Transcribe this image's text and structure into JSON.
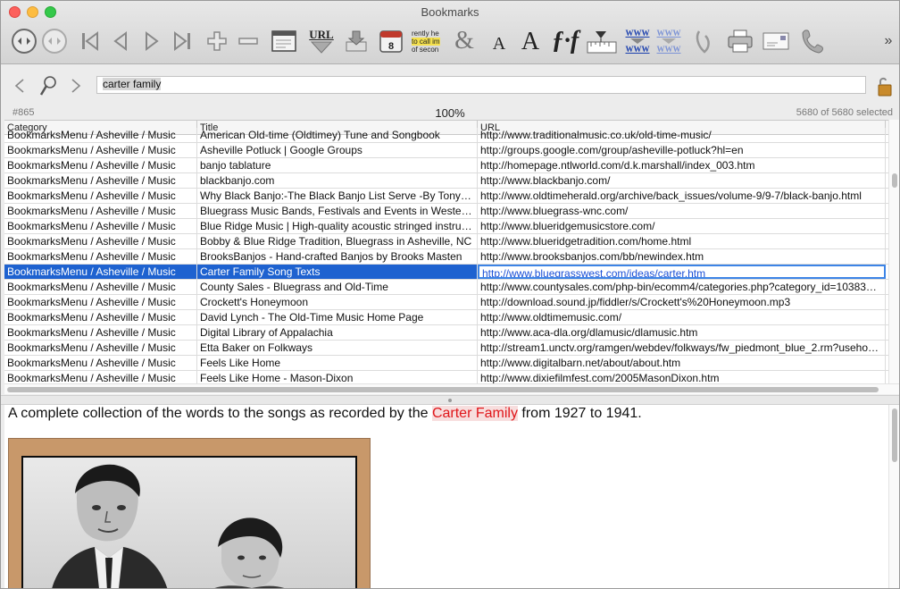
{
  "window": {
    "title": "Bookmarks"
  },
  "toolbar": {
    "items": [
      {
        "name": "navigate-back-icon"
      },
      {
        "name": "navigate-forward-icon"
      },
      {
        "name": "first-record-icon"
      },
      {
        "name": "previous-record-icon"
      },
      {
        "name": "next-record-icon"
      },
      {
        "name": "last-record-icon"
      },
      {
        "name": "add-record-icon"
      },
      {
        "name": "delete-record-icon"
      },
      {
        "name": "window-icon"
      },
      {
        "name": "url-download-icon"
      },
      {
        "name": "open-tray-icon"
      },
      {
        "name": "calendar-icon"
      },
      {
        "name": "text-preview-icon"
      },
      {
        "name": "ampersand-icon"
      },
      {
        "name": "font-smaller-icon"
      },
      {
        "name": "font-larger-icon"
      },
      {
        "name": "function-icon"
      },
      {
        "name": "ruler-icon"
      },
      {
        "name": "www-link-icon"
      },
      {
        "name": "www-unlink-icon"
      },
      {
        "name": "clip-icon"
      },
      {
        "name": "printer-icon"
      },
      {
        "name": "envelope-icon"
      },
      {
        "name": "phone-icon"
      },
      {
        "name": "overflow-chevron-icon"
      }
    ],
    "url_label": "URL",
    "calendar_day": "8",
    "preview_lines": [
      "rently he",
      "to call im",
      "of secon"
    ],
    "font_a": "A",
    "www": "WWW"
  },
  "search": {
    "value": "carter family"
  },
  "status": {
    "record": "#865",
    "zoom": "100%",
    "selection": "5680 of 5680 selected"
  },
  "table": {
    "columns": [
      "Category",
      "Title",
      "URL"
    ],
    "partial_row": [
      "BookmarksMenu / Asheville / Music",
      "American Old-time (Oldtimey) Tune and Songbook",
      "http://www.traditionalmusic.co.uk/old-time-music/"
    ],
    "rows": [
      [
        "BookmarksMenu / Asheville / Music",
        "Asheville Potluck | Google Groups",
        "http://groups.google.com/group/asheville-potluck?hl=en"
      ],
      [
        "BookmarksMenu / Asheville / Music",
        "banjo tablature",
        "http://homepage.ntlworld.com/d.k.marshall/index_003.htm"
      ],
      [
        "BookmarksMenu / Asheville / Music",
        "blackbanjo.com",
        "http://www.blackbanjo.com/"
      ],
      [
        "BookmarksMenu / Asheville / Music",
        "Why Black Banjo:-The Black Banjo List Serve -By Tony…",
        "http://www.oldtimeherald.org/archive/back_issues/volume-9/9-7/black-banjo.html"
      ],
      [
        "BookmarksMenu / Asheville / Music",
        "Bluegrass Music Bands, Festivals and Events in Weste…",
        "http://www.bluegrass-wnc.com/"
      ],
      [
        "BookmarksMenu / Asheville / Music",
        "Blue Ridge Music | High-quality acoustic stringed instru…",
        "http://www.blueridgemusicstore.com/"
      ],
      [
        "BookmarksMenu / Asheville / Music",
        "Bobby & Blue Ridge Tradition, Bluegrass in Asheville, NC",
        "http://www.blueridgetradition.com/home.html"
      ],
      [
        "BookmarksMenu / Asheville / Music",
        "BrooksBanjos - Hand-crafted Banjos by Brooks Masten",
        "http://www.brooksbanjos.com/bb/newindex.htm"
      ],
      [
        "BookmarksMenu / Asheville / Music",
        "Carter Family Song Texts",
        "http://www.bluegrasswest.com/ideas/carter.htm"
      ],
      [
        "BookmarksMenu / Asheville / Music",
        "County Sales - Bluegrass and Old-Time",
        "http://www.countysales.com/php-bin/ecomm4/categories.php?category_id=10383…"
      ],
      [
        "BookmarksMenu / Asheville / Music",
        "Crockett's Honeymoon",
        "http://download.sound.jp/fiddler/s/Crockett's%20Honeymoon.mp3"
      ],
      [
        "BookmarksMenu / Asheville / Music",
        "David Lynch - The Old-Time Music Home Page",
        "http://www.oldtimemusic.com/"
      ],
      [
        "BookmarksMenu / Asheville / Music",
        "Digital Library of Appalachia",
        "http://www.aca-dla.org/dlamusic/dlamusic.htm"
      ],
      [
        "BookmarksMenu / Asheville / Music",
        "Etta Baker on Folkways",
        "http://stream1.unctv.org/ramgen/webdev/folkways/fw_piedmont_blue_2.rm?useho…"
      ],
      [
        "BookmarksMenu / Asheville / Music",
        "Feels Like Home",
        "http://www.digitalbarn.net/about/about.htm"
      ],
      [
        "BookmarksMenu / Asheville / Music",
        "Feels Like Home - Mason-Dixon",
        "http://www.dixiefilmfest.com/2005MasonDixon.htm"
      ]
    ],
    "selected_index": 8
  },
  "description": {
    "before": "A complete collection of the words to the songs as recorded by the ",
    "highlight": "Carter Family",
    "after": " from 1927 to 1941."
  },
  "colors": {
    "selection": "#1e62d0",
    "highlight_text": "#e0161a",
    "link": "#1a4fd6"
  }
}
